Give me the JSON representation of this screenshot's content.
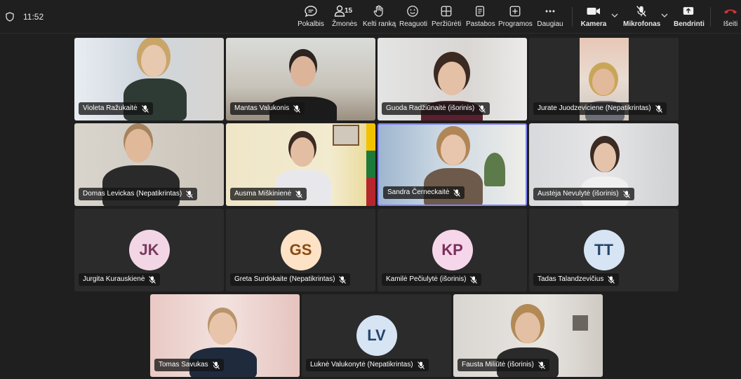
{
  "status": {
    "time": "11:52"
  },
  "toolbar": {
    "chat": "Pokalbis",
    "people": "Žmonės",
    "people_count": "15",
    "raise": "Kelti ranką",
    "react": "Reaguoti",
    "view": "Peržiūrėti",
    "notes": "Pastabos",
    "apps": "Programos",
    "more": "Daugiau",
    "camera": "Kamera",
    "mic": "Mikrofonas",
    "share": "Bendrinti",
    "leave": "Išeiti"
  },
  "colors": {
    "leave": "#d13438",
    "active_border": "#7f85f5",
    "bg": "#1f1f1f"
  },
  "participants": [
    {
      "name": "Violeta Ražukaitė"
    },
    {
      "name": "Mantas Valukonis"
    },
    {
      "name": "Guoda Radžiūnaitė (išorinis)"
    },
    {
      "name": "Jurate Juodzeviciene (Nepatikrintas)"
    },
    {
      "name": "Domas Levickas (Nepatikrintas)"
    },
    {
      "name": "Ausma Miškinienė"
    },
    {
      "name": "Sandra Černeckaitė"
    },
    {
      "name": "Austėja Nevulytė (išorinis)"
    },
    {
      "name": "Jurgita Kurauskienė",
      "initials": "JK",
      "avatar_bg": "#f3d6e6",
      "avatar_fg": "#7a3a5c"
    },
    {
      "name": "Greta Surdokaite (Nepatikrintas)",
      "initials": "GS",
      "avatar_bg": "#fde2c6",
      "avatar_fg": "#8a4b12"
    },
    {
      "name": "Kamilė Pečiulytė (išorinis)",
      "initials": "KP",
      "avatar_bg": "#f6d6ea",
      "avatar_fg": "#7a2f5b"
    },
    {
      "name": "Tadas Talandzevičius",
      "initials": "TT",
      "avatar_bg": "#d6e4f3",
      "avatar_fg": "#24456b"
    },
    {
      "name": "Tomas Savukas"
    },
    {
      "name": "Luknė Valukonytė (Nepatikrintas)",
      "initials": "LV",
      "avatar_bg": "#d6e4f3",
      "avatar_fg": "#24456b"
    },
    {
      "name": "Fausta Miliūtė (išorinis)"
    }
  ]
}
